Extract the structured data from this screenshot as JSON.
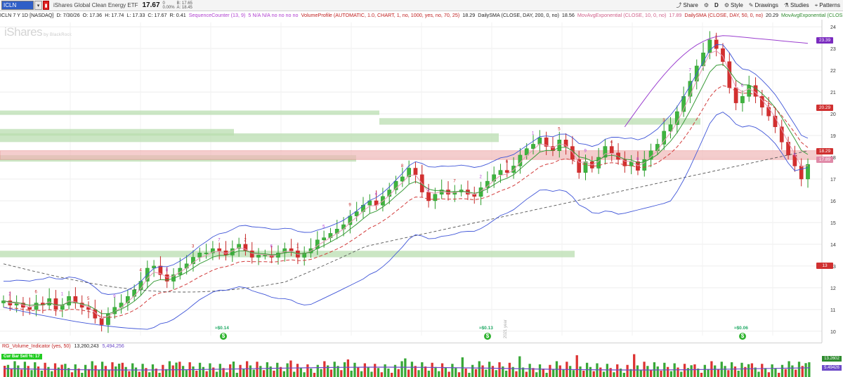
{
  "symbol": {
    "value": "ICLN",
    "description": "iShares Global Clean Energy ETF",
    "last": "17.67",
    "change": "0",
    "change_pct": "0.00%",
    "bid": "B: 17.65",
    "ask": "A: 18.45"
  },
  "toolbar": {
    "share": "Share",
    "period": "D",
    "style": "Style",
    "drawings": "Drawings",
    "studies": "Studies",
    "patterns": "Patterns"
  },
  "studies": {
    "ohlc": "ICLN 7 Y 1D [NASDAQ]",
    "date": "D: 7/30/26",
    "open": "O: 17.36",
    "high": "H: 17.74",
    "low": "L: 17.33",
    "close": "C: 17.67",
    "range": "R: 0.41",
    "seq": "SequenceCounter (13, 9)",
    "seq_vals": "5  N/A  N/A  no  no  no  no",
    "vp": "VolumeProfile (AUTOMATIC, 1.0, CHART, 1, no, 1000, yes, no, 70, 25)",
    "vp_val": "18.29",
    "dsma": "DailySMA (CLOSE, DAY, 200, 0, no)",
    "dsma_val": "18.56",
    "mema": "MovAvgExponential (CLOSE, 10, 0, no)",
    "mema_val": "17.89",
    "dsma50": "DailySMA (CLOSE, DAY, 50, 0, no)",
    "dsma50_val": "20.29",
    "mema2": "MovAvgExponential (CLOSE,"
  },
  "logo": {
    "brand": "iShares",
    "by": "by BlackRock"
  },
  "price_axis": {
    "ticks": [
      "24",
      "23",
      "22",
      "21",
      "20",
      "19",
      "18",
      "17",
      "16",
      "15",
      "14",
      "13",
      "12",
      "11",
      "10"
    ]
  },
  "price_tags": [
    {
      "label": "23.39",
      "color": "#7a2bbf"
    },
    {
      "label": "20.29",
      "color": "#d03030"
    },
    {
      "label": "18.29",
      "color": "#d03030"
    },
    {
      "label": "17.89",
      "color": "#e08aa8"
    },
    {
      "label": "13",
      "color": "#d03030"
    }
  ],
  "dividends": [
    {
      "label": "≈$0.14"
    },
    {
      "label": "≈$0.13"
    },
    {
      "label": "≈$0.06"
    }
  ],
  "dividend_icon": "dollar-icon",
  "year_label": "2021 year",
  "volume": {
    "name": "RG_Volume_Indicator (yes, 50)",
    "value": "13,260,243",
    "avg": "5,494,256",
    "cur_bar": "Cur Bar Sell %: 17",
    "tag_vol": "13.2602",
    "tag_avg": "5.49426",
    "tag_vol_color": "#2e8b2e",
    "tag_avg_color": "#6d4bc8"
  },
  "chart_data": {
    "type": "candlestick",
    "ylim": [
      10,
      24
    ],
    "close": [
      11.4,
      11.2,
      11.3,
      11.1,
      11.0,
      11.3,
      11.2,
      11.5,
      11.0,
      11.2,
      11.6,
      11.3,
      11.1,
      11.0,
      10.6,
      10.3,
      10.8,
      11.1,
      11.3,
      11.6,
      11.9,
      12.3,
      12.9,
      13.0,
      12.6,
      12.3,
      12.6,
      12.9,
      13.1,
      13.4,
      13.6,
      13.6,
      13.8,
      13.7,
      13.5,
      13.8,
      14.0,
      13.7,
      13.4,
      13.5,
      13.5,
      13.4,
      13.6,
      13.8,
      13.7,
      13.4,
      13.6,
      13.8,
      14.2,
      14.3,
      14.5,
      14.7,
      14.9,
      15.3,
      15.5,
      15.8,
      16.0,
      15.8,
      16.2,
      16.5,
      16.9,
      17.1,
      17.5,
      17.2,
      16.4,
      16.0,
      16.3,
      16.5,
      16.3,
      16.4,
      16.5,
      16.3,
      16.2,
      16.6,
      16.9,
      17.2,
      17.4,
      17.3,
      17.6,
      18.1,
      18.4,
      18.6,
      18.9,
      18.5,
      18.3,
      18.8,
      18.5,
      17.9,
      17.3,
      17.8,
      17.5,
      18.0,
      18.5,
      18.2,
      17.9,
      17.6,
      17.8,
      17.4,
      17.9,
      18.3,
      18.6,
      19.2,
      19.5,
      20.1,
      20.8,
      21.5,
      22.2,
      22.8,
      23.4,
      23.0,
      22.4,
      21.2,
      20.5,
      20.8,
      21.3,
      20.8,
      20.3,
      19.9,
      19.4,
      18.7,
      18.1,
      17.6,
      17.0,
      17.67
    ],
    "sma200_start": 13.1,
    "sma200_end": 18.3,
    "support_zones": [
      [
        19.5,
        19.8
      ],
      [
        18.7,
        19.1
      ],
      [
        18.0,
        18.4
      ],
      [
        17.8,
        18.1
      ],
      [
        13.4,
        13.7
      ]
    ],
    "resistance_zone": [
      17.9,
      18.3
    ],
    "dividend_amounts": [
      0.14,
      0.13,
      0.06
    ]
  }
}
